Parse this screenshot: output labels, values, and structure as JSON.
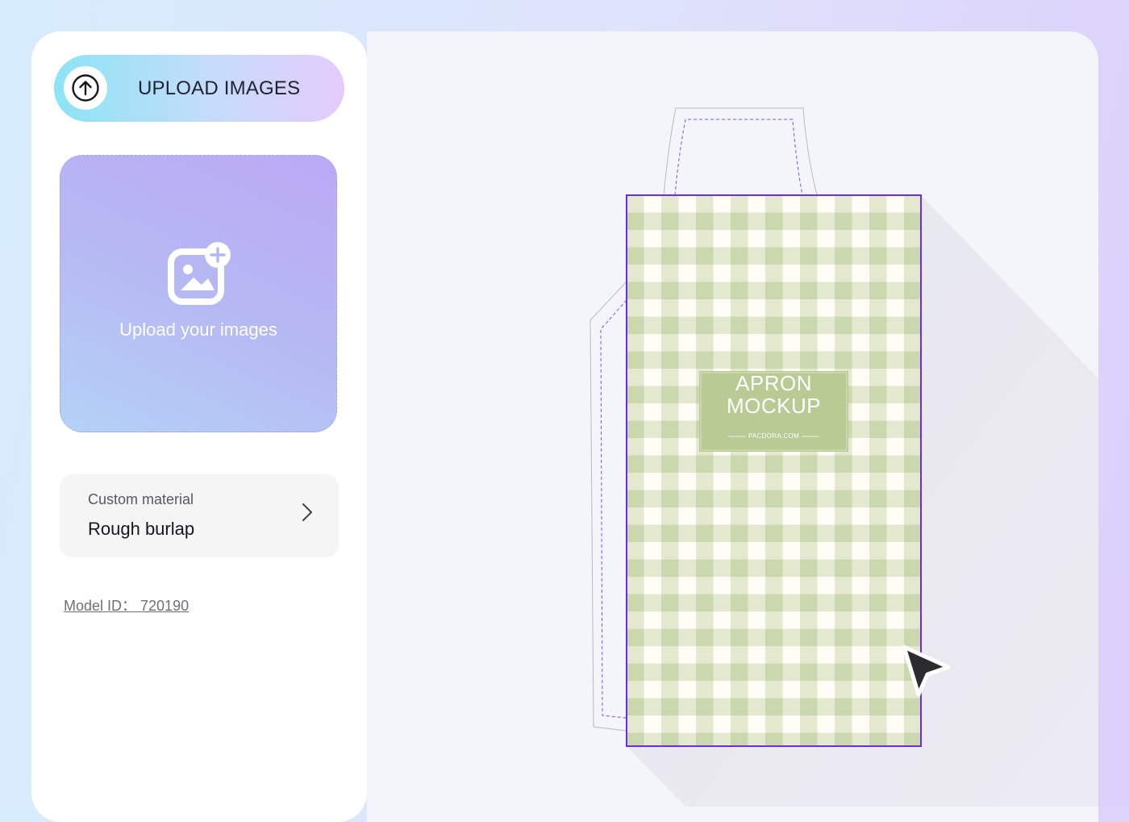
{
  "sidebar": {
    "upload_button_label": "UPLOAD IMAGES",
    "drop_zone_label": "Upload your images",
    "material": {
      "caption": "Custom material",
      "value": "Rough burlap"
    },
    "model_id": "Model ID： 720190"
  },
  "preview": {
    "label_title_line1": "APRON",
    "label_title_line2": "MOCKUP",
    "label_brand": "PACDORA.COM",
    "pattern": "green gingham"
  },
  "icons": [
    "arrow-up-circle-icon",
    "image-add-icon",
    "chevron-right-icon",
    "cursor-pointer-icon"
  ],
  "colors": {
    "accent_outline": "#6a2de6",
    "gingham_dark": "#cbd8af",
    "gingham_light": "#e3e8cf",
    "gingham_white": "#fefcf4",
    "label_bg": "#b9ca94"
  }
}
